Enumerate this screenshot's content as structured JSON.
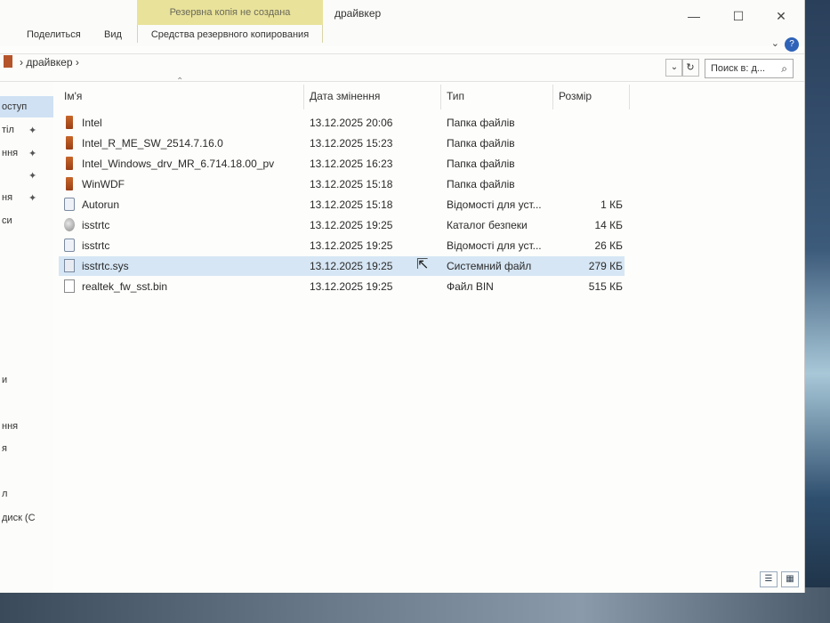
{
  "window": {
    "context_tab": "Резервна копія не создана",
    "title": "драйвкер",
    "controls": {
      "minimize": "—",
      "maximize": "☐",
      "close": "✕"
    }
  },
  "ribbon": {
    "tabs": [
      {
        "label": "Поделиться"
      },
      {
        "label": "Вид"
      }
    ],
    "context_label": "Средства резервного копирования",
    "help": "?",
    "collapse": "⌄"
  },
  "address": {
    "path": "›  драйвкер  ›",
    "dropdown": "⌄",
    "refresh": "↻",
    "search_placeholder": "Поиск в: д...",
    "search_icon": "search-icon"
  },
  "nav": {
    "items": [
      {
        "label": "оступ",
        "selected": true
      },
      {
        "label": "тіл",
        "pinned": true
      },
      {
        "label": "ння",
        "pinned": true
      },
      {
        "label": "",
        "pinned": true
      },
      {
        "label": "ня",
        "pinned": true
      },
      {
        "label": "си"
      },
      {
        "label": "и"
      },
      {
        "label": "ння"
      },
      {
        "label": "я"
      },
      {
        "label": "л"
      },
      {
        "label": "диск (С"
      }
    ],
    "pin_glyph": "📌"
  },
  "columns": {
    "name": "Ім'я",
    "date": "Дата змінення",
    "type": "Тип",
    "size": "Розмір"
  },
  "files": [
    {
      "name": "Intel",
      "date": "13.12.2025 20:06",
      "type": "Папка файлів",
      "size": "",
      "icon": "folder-icon"
    },
    {
      "name": "Intel_R_ME_SW_2514.7.16.0",
      "date": "13.12.2025 15:23",
      "type": "Папка файлів",
      "size": "",
      "icon": "folder-icon"
    },
    {
      "name": "Intel_Windows_drv_MR_6.714.18.00_pv",
      "date": "13.12.2025 16:23",
      "type": "Папка файлів",
      "size": "",
      "icon": "folder-icon"
    },
    {
      "name": "WinWDF",
      "date": "13.12.2025 15:18",
      "type": "Папка файлів",
      "size": "",
      "icon": "folder-icon"
    },
    {
      "name": "Autorun",
      "date": "13.12.2025 15:18",
      "type": "Відомості для уст...",
      "size": "1 КБ",
      "icon": "setup-info-icon"
    },
    {
      "name": "isstrtc",
      "date": "13.12.2025 19:25",
      "type": "Каталог безпеки",
      "size": "14 КБ",
      "icon": "security-catalog-icon"
    },
    {
      "name": "isstrtc",
      "date": "13.12.2025 19:25",
      "type": "Відомості для уст...",
      "size": "26 КБ",
      "icon": "setup-info-icon"
    },
    {
      "name": "isstrtc.sys",
      "date": "13.12.2025 19:25",
      "type": "Системний файл",
      "size": "279 КБ",
      "icon": "system-file-icon",
      "selected": true
    },
    {
      "name": "realtek_fw_sst.bin",
      "date": "13.12.2025 19:25",
      "type": "Файл BIN",
      "size": "515 КБ",
      "icon": "file-icon"
    }
  ],
  "statusbar": {
    "details_view": "☰",
    "tiles_view": "▦"
  }
}
